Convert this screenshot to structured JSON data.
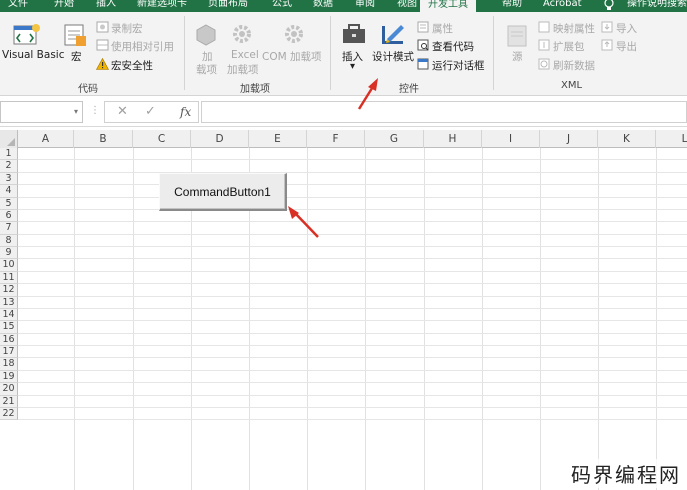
{
  "ribbon_tabs": [
    "文件",
    "开始",
    "插入",
    "新建选项卡",
    "页面布局",
    "公式",
    "数据",
    "审阅",
    "视图",
    "开发工具",
    "帮助",
    "Acrobat",
    "操作说明搜索"
  ],
  "active_tab": "开发工具",
  "code_group": {
    "label": "代码",
    "visual_basic": "Visual Basic",
    "macros": "宏",
    "record_macro": "录制宏",
    "relative_refs": "使用相对引用",
    "macro_security": "宏安全性"
  },
  "addins_group": {
    "label": "加载项",
    "addins_line1": "加",
    "addins_line2": "载项",
    "excel_addins_line1": "Excel",
    "excel_addins_line2": "加载项",
    "com_addins": "COM 加载项"
  },
  "controls_group": {
    "label": "控件",
    "insert": "插入",
    "design_mode": "设计模式",
    "properties": "属性",
    "view_code": "查看代码",
    "run_dialog": "运行对话框"
  },
  "xml_group": {
    "label": "XML",
    "source": "源",
    "map_properties": "映射属性",
    "expansion_packs": "扩展包",
    "refresh_data": "刷新数据",
    "import": "导入",
    "export": "导出"
  },
  "formula_bar": {
    "name_box": "",
    "cancel_symbol": "✕",
    "enter_symbol": "✓",
    "fx": "fx",
    "content": ""
  },
  "columns": [
    "A",
    "B",
    "C",
    "D",
    "E",
    "F",
    "G",
    "H",
    "I",
    "J",
    "K",
    "L"
  ],
  "rows": [
    "1",
    "2",
    "3",
    "4",
    "5",
    "6",
    "7",
    "8",
    "9",
    "10",
    "11",
    "12",
    "13",
    "14",
    "15",
    "16",
    "17",
    "18",
    "19",
    "20",
    "21",
    "22"
  ],
  "command_button": {
    "caption": "CommandButton1"
  },
  "watermark": "码界编程网",
  "colors": {
    "ribbon_green": "#217346",
    "arrow_red": "#d93025",
    "warning_yellow": "#f0b400"
  },
  "icons": [
    "visual-basic-icon",
    "macros-icon",
    "record-macro-icon",
    "relative-refs-icon",
    "warning-icon",
    "addins-icon",
    "excel-addins-gear-icon",
    "com-addins-gear-icon",
    "insert-toolbox-icon",
    "design-mode-icon",
    "properties-icon",
    "view-code-icon",
    "run-dialog-icon",
    "xml-source-icon",
    "map-properties-icon",
    "expansion-packs-icon",
    "refresh-data-icon",
    "import-icon",
    "export-icon",
    "lightbulb-icon"
  ]
}
